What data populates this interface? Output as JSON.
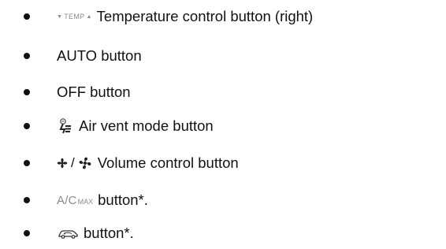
{
  "items": [
    {
      "icon": "temp-up-down-icon",
      "icon_text": "TEMP",
      "text": "Temperature control button (right)"
    },
    {
      "icon": "",
      "text": "AUTO button"
    },
    {
      "icon": "",
      "text": "OFF button"
    },
    {
      "icon": "air-vent-mode-icon",
      "text": "Air vent mode button"
    },
    {
      "icon": "fan-speed-icon",
      "separator": "/",
      "text": "Volume control button"
    },
    {
      "icon": "ac-max-icon",
      "icon_text": "A/C",
      "icon_subtext": "MAX",
      "text": "button*."
    },
    {
      "icon": "air-recirculation-icon",
      "text": "button*."
    }
  ],
  "colors": {
    "text": "#111111",
    "icon_gray": "#8a8a8a"
  }
}
